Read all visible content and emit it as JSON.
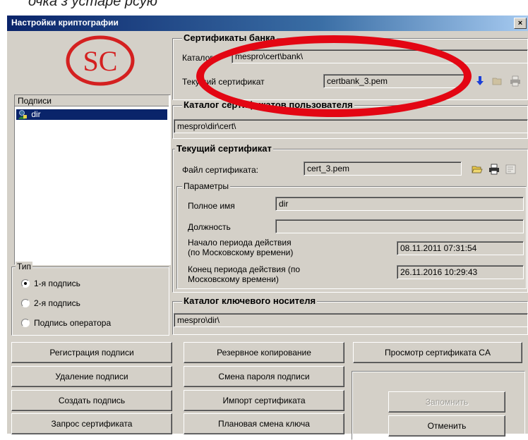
{
  "window": {
    "title": "Настройки криптографии",
    "close_symbol": "×"
  },
  "caption_fragment": "очка з устаре рсую",
  "logo": {
    "text": "SC"
  },
  "signatures": {
    "header": "Подписи",
    "items": [
      {
        "label": "dir",
        "selected": true
      }
    ]
  },
  "bank_certs": {
    "legend": "Сертификаты банка",
    "catalog_label": "Каталог",
    "catalog_value": "mespro\\cert\\bank\\",
    "current_label": "Текущий сертификат",
    "current_value": "certbank_3.pem"
  },
  "user_certs": {
    "legend": "Каталог сертификатов пользователя",
    "value": "mespro\\dir\\cert\\"
  },
  "current_cert": {
    "legend": "Текущий сертификат",
    "file_label": "Файл сертификата:",
    "file_value": "cert_3.pem",
    "params": {
      "legend": "Параметры",
      "full_name_label": "Полное имя",
      "full_name_value": "dir",
      "position_label": "Должность",
      "position_value": "",
      "start_label_1": "Начало периода действия",
      "start_label_2": "(по Московскому времени)",
      "start_value": "08.11.2011 07:31:54",
      "end_label_1": "Конец периода действия (по",
      "end_label_2": "Московскому времени)",
      "end_value": "26.11.2016 10:29:43"
    }
  },
  "key_catalog": {
    "legend": "Каталог ключевого носителя",
    "value": "mespro\\dir\\"
  },
  "type_group": {
    "legend": "Тип",
    "options": [
      {
        "label": "1-я подпись",
        "checked": true
      },
      {
        "label": "2-я подпись",
        "checked": false
      },
      {
        "label": "Подпись оператора",
        "checked": false
      }
    ]
  },
  "buttons": {
    "register": "Регистрация подписи",
    "delete": "Удаление подписи",
    "create": "Создать подпись",
    "request": "Запрос сертификата",
    "backup": "Резервное копирование",
    "change_password": "Смена пароля подписи",
    "import": "Импорт сертификата",
    "key_change": "Плановая смена ключа",
    "view_ca": "Просмотр сертификата CA",
    "save": "Запомнить",
    "cancel": "Отменить"
  },
  "colors": {
    "title_bar": "#0a246a",
    "dialog_bg": "#d4d0c8",
    "annotation_oval": "#e30613",
    "logo_red": "#d42020",
    "download_arrow": "#1a3fd8"
  },
  "icons": [
    "logo-sc",
    "user-certificate-icon",
    "download-arrow-icon",
    "folder-open-icon",
    "printer-icon",
    "certificate-icon"
  ]
}
